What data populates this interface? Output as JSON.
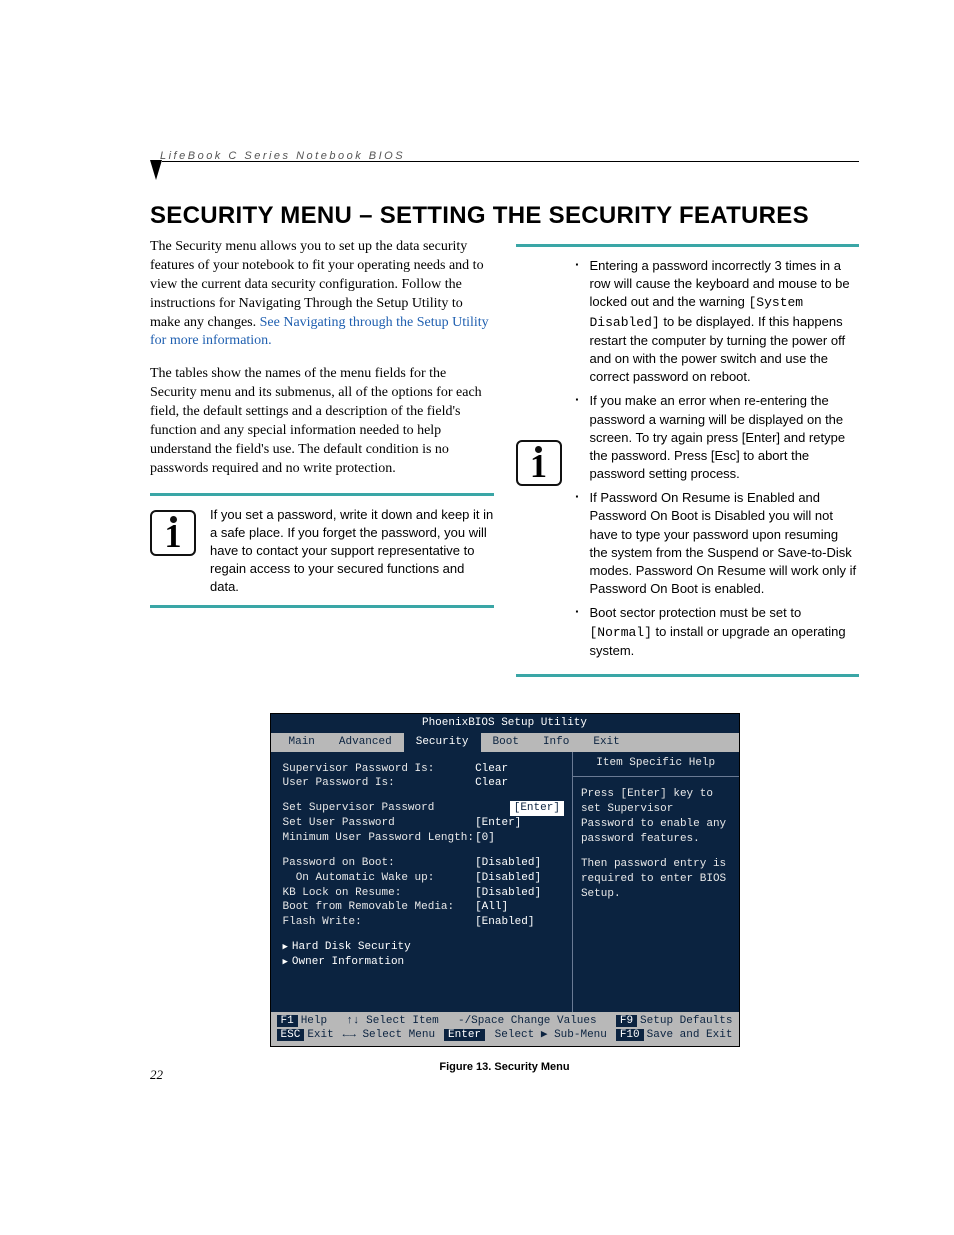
{
  "running_head": "LifeBook C Series Notebook BIOS",
  "title": "SECURITY MENU – SETTING THE SECURITY FEATURES",
  "left": {
    "p1a": "The Security menu allows you to set up the data security features of your notebook to fit your operating needs and to view the current data security configuration. Follow the instructions for Navigating Through the Setup Utility to make any changes. ",
    "p1_link": "See Navigating through the Setup Utility for more information.",
    "p2": "The tables show the names of the menu fields for the Security menu and its submenus, all of the options for each field, the default settings and a description of the field's function and any special information needed to help understand the field's use. The default condition is no passwords required and no write protection.",
    "callout": "If you set a password, write it down and keep it in a safe place. If you forget the password, you will have to contact your support representative to regain access to your secured functions and data."
  },
  "right": {
    "b1a": "Entering a password incorrectly 3 times in a row will cause the keyboard and mouse to be locked out and the warning ",
    "b1_mono": "[System Disabled]",
    "b1b": " to be displayed. If this happens restart the computer by turning the power off and on with the power switch and use the correct password on reboot.",
    "b2": "If you make an error when re-entering the password a warning will be displayed on the screen. To try again press [Enter] and retype the password. Press [Esc] to abort the password setting process.",
    "b3": "If Password On Resume is Enabled and Password On Boot is Disabled you will not have to type your password upon resuming the system from the Suspend or Save-to-Disk modes. Password On Resume will work only if Password On Boot is enabled.",
    "b4a": "Boot sector protection must be set to ",
    "b4_mono": "[Normal]",
    "b4b": " to install or upgrade an operating system."
  },
  "bios": {
    "title": "PhoenixBIOS Setup Utility",
    "tabs": [
      "Main",
      "Advanced",
      "Security",
      "Boot",
      "Info",
      "Exit"
    ],
    "active_tab": "Security",
    "rows": [
      {
        "label": "Supervisor Password Is:",
        "value": "Clear"
      },
      {
        "label": "User Password Is:",
        "value": "Clear"
      },
      {
        "label": "",
        "value": ""
      },
      {
        "label": "Set Supervisor Password",
        "value": "[Enter]",
        "selected": true
      },
      {
        "label": "Set User Password",
        "value": "[Enter]"
      },
      {
        "label": "Minimum User Password Length:",
        "value": "[0]"
      },
      {
        "label": "",
        "value": ""
      },
      {
        "label": "Password on Boot:",
        "value": "[Disabled]"
      },
      {
        "label": "  On Automatic Wake up:",
        "value": "[Disabled]"
      },
      {
        "label": "KB Lock on Resume:",
        "value": "[Disabled]"
      },
      {
        "label": "Boot from Removable Media:",
        "value": "[All]"
      },
      {
        "label": "Flash Write:",
        "value": "[Enabled]"
      }
    ],
    "submenus": [
      "Hard Disk Security",
      "Owner Information"
    ],
    "help_title": "Item Specific Help",
    "help_p1": "Press [Enter] key to set Supervisor Password to enable any password features.",
    "help_p2": "Then password entry is required to enter BIOS Setup.",
    "footer": {
      "r1": {
        "k1": "F1",
        "l1": "Help",
        "g1": "↑↓ Select Item",
        "g2": "-/Space",
        "l2": "Change Values",
        "k2": "F9",
        "l3": "Setup Defaults"
      },
      "r2": {
        "k1": "ESC",
        "l1": "Exit",
        "g1": "←→ Select Menu",
        "g2": "Enter",
        "l2": "Select ▶ Sub-Menu",
        "k2": "F10",
        "l3": "Save and Exit"
      }
    }
  },
  "caption": "Figure 13.  Security Menu",
  "page_number": "22"
}
